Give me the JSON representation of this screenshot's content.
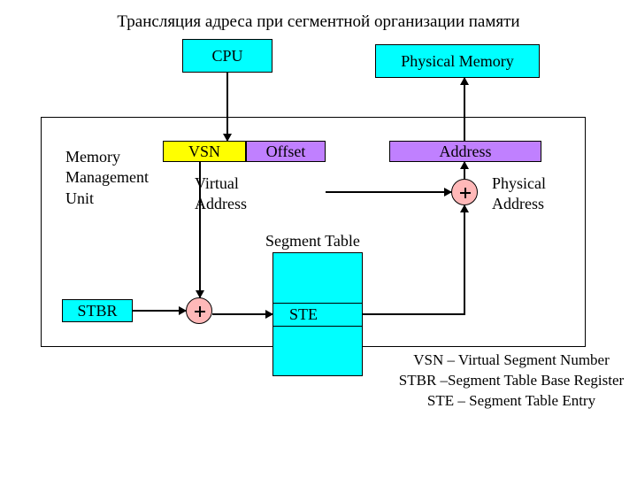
{
  "title": "Трансляция адреса при сегментной организации памяти",
  "boxes": {
    "cpu": "CPU",
    "physical_memory": "Physical Memory",
    "vsn": "VSN",
    "offset": "Offset",
    "address": "Address",
    "stbr": "STBR",
    "ste": "STE"
  },
  "labels": {
    "mmu": "Memory\nManagement\nUnit",
    "virtual_address": "Virtual\nAddress",
    "physical_address": "Physical\nAddress",
    "segment_table": "Segment Table"
  },
  "ops": {
    "plus1": "+",
    "plus2": "+"
  },
  "descriptions": {
    "vsn": "VSN – Virtual Segment Number",
    "stbr": "STBR –Segment Table Base Register",
    "ste": "STE – Segment Table Entry"
  }
}
